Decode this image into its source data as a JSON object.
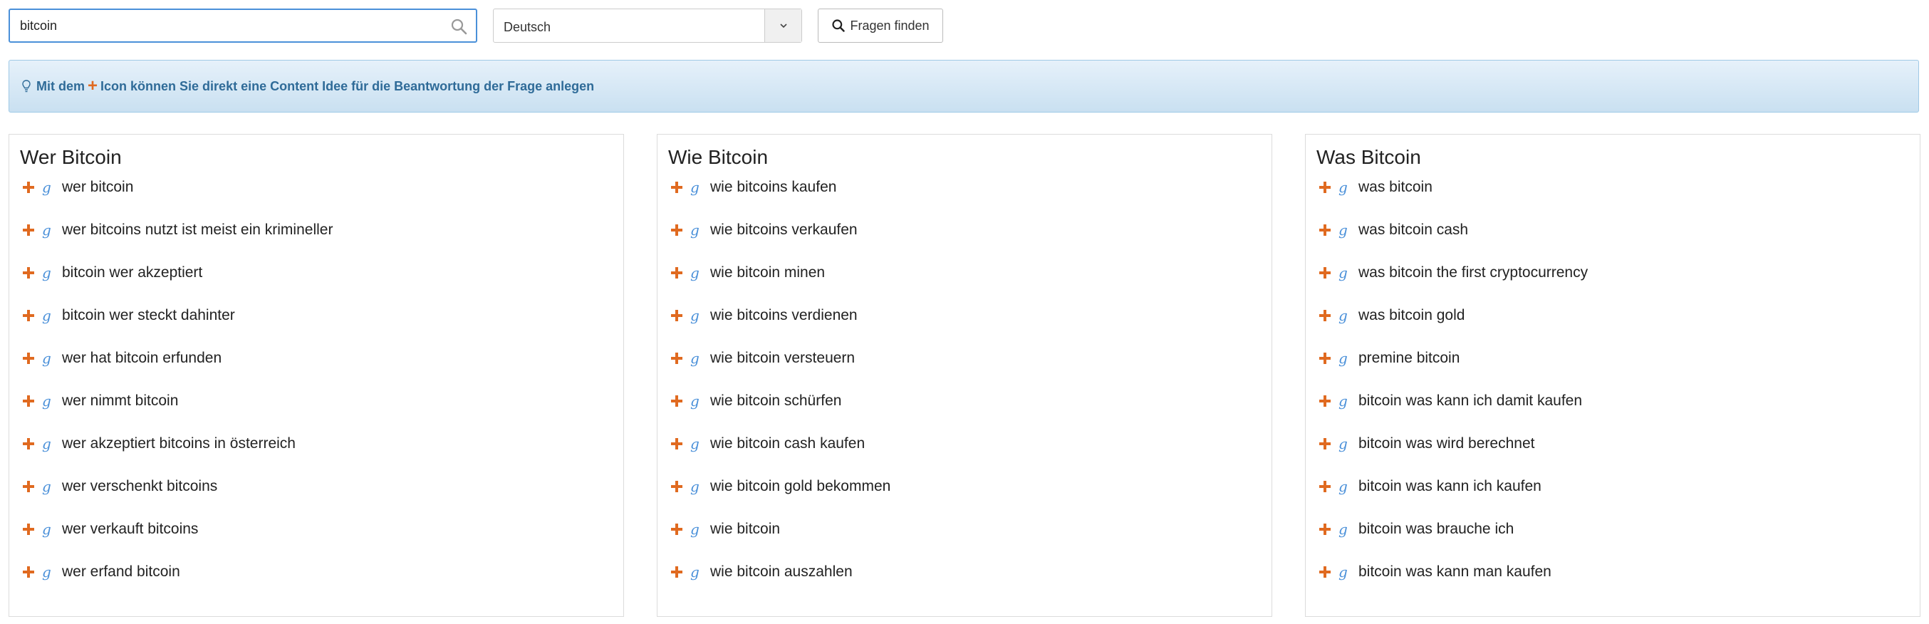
{
  "search": {
    "value": "bitcoin"
  },
  "language": {
    "selected": "Deutsch"
  },
  "find_button": {
    "label": "Fragen finden"
  },
  "info": {
    "prefix": "Mit dem",
    "suffix": "Icon können Sie direkt eine Content Idee für die Beantwortung der Frage anlegen"
  },
  "icons": {
    "add": "plus-icon",
    "google": "google-g-icon",
    "search": "search-icon",
    "bulb": "lightbulb-icon"
  },
  "colors": {
    "accent_orange": "#e06a20",
    "link_blue": "#4a90d9",
    "info_text": "#2f6b98"
  },
  "columns": [
    {
      "title": "Wer Bitcoin",
      "items": [
        "wer bitcoin",
        "wer bitcoins nutzt ist meist ein krimineller",
        "bitcoin wer akzeptiert",
        "bitcoin wer steckt dahinter",
        "wer hat bitcoin erfunden",
        "wer nimmt bitcoin",
        "wer akzeptiert bitcoins in österreich",
        "wer verschenkt bitcoins",
        "wer verkauft bitcoins",
        "wer erfand bitcoin"
      ]
    },
    {
      "title": "Wie Bitcoin",
      "items": [
        "wie bitcoins kaufen",
        "wie bitcoins verkaufen",
        "wie bitcoin minen",
        "wie bitcoins verdienen",
        "wie bitcoin versteuern",
        "wie bitcoin schürfen",
        "wie bitcoin cash kaufen",
        "wie bitcoin gold bekommen",
        "wie bitcoin",
        "wie bitcoin auszahlen"
      ]
    },
    {
      "title": "Was Bitcoin",
      "items": [
        "was bitcoin",
        "was bitcoin cash",
        "was bitcoin the first cryptocurrency",
        "was bitcoin gold",
        "premine bitcoin",
        "bitcoin was kann ich damit kaufen",
        "bitcoin was wird berechnet",
        "bitcoin was kann ich kaufen",
        "bitcoin was brauche ich",
        "bitcoin was kann man kaufen"
      ]
    }
  ]
}
